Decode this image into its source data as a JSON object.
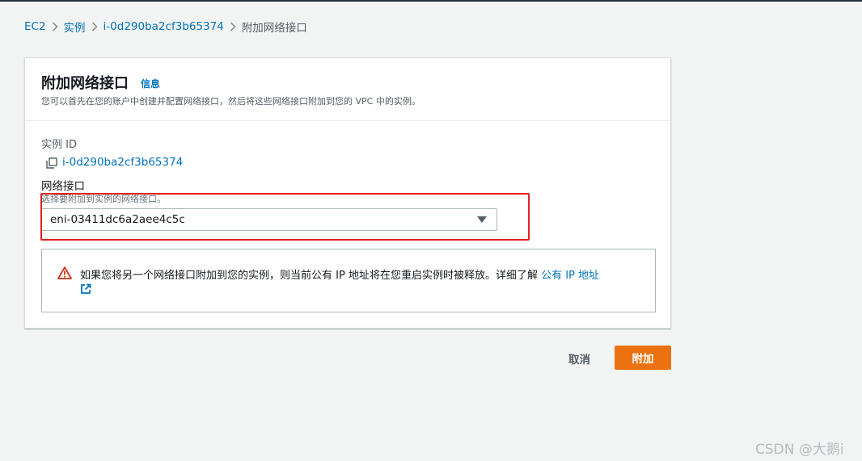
{
  "breadcrumb": {
    "items": [
      "EC2",
      "实例",
      "i-0d290ba2cf3b65374"
    ],
    "current": "附加网络接口"
  },
  "card": {
    "title": "附加网络接口",
    "info_link": "信息",
    "description": "您可以首先在您的账户中创建并配置网络接口，然后将这些网络接口附加到您的 VPC 中的实例。"
  },
  "instance": {
    "label": "实例 ID",
    "id": "i-0d290ba2cf3b65374",
    "copy_icon": "copy-icon"
  },
  "network_interface": {
    "label": "网络接口",
    "description": "选择要附加到实例的网络接口。",
    "selected": "eni-03411dc6a2aee4c5c"
  },
  "alert": {
    "icon": "warning-icon",
    "text": "如果您将另一个网络接口附加到您的实例，则当前公有 IP 地址将在您重启实例时被释放。详细了解 ",
    "link": "公有 IP 地址",
    "link_icon": "external-link-icon"
  },
  "actions": {
    "cancel": "取消",
    "attach": "附加"
  },
  "colors": {
    "link": "#0073bb",
    "primary_button": "#ec7211",
    "highlight_box": "#e02020",
    "warning": "#d13212"
  },
  "watermark": "CSDN @大鹅i"
}
